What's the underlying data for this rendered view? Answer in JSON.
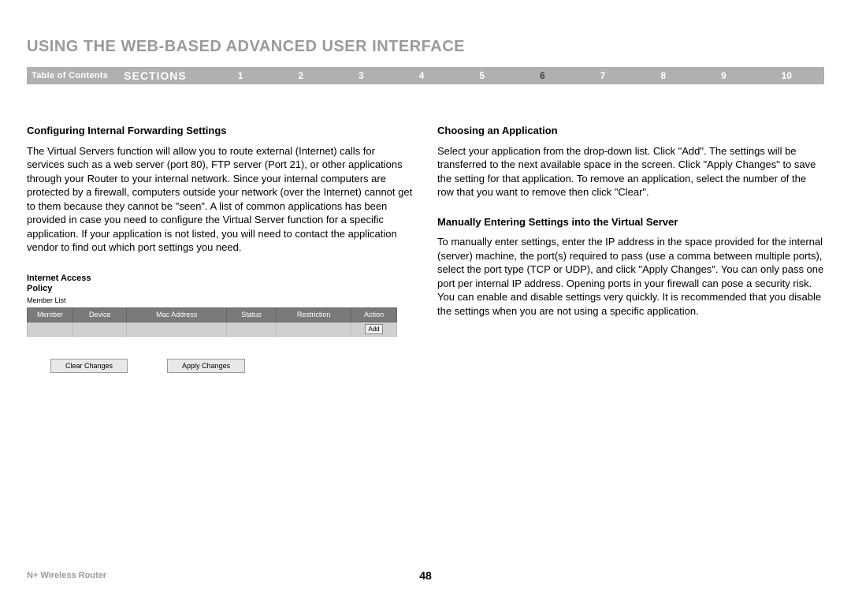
{
  "title": "USING THE WEB-BASED ADVANCED USER INTERFACE",
  "nav": {
    "toc": "Table of Contents",
    "sections_label": "SECTIONS",
    "sections": [
      "1",
      "2",
      "3",
      "4",
      "5",
      "6",
      "7",
      "8",
      "9",
      "10"
    ],
    "active": "6"
  },
  "left": {
    "h1": "Configuring Internal Forwarding Settings",
    "p1": "The Virtual Servers function will allow you to route external (Internet) calls for services such as a web server (port 80), FTP server (Port 21), or other applications through your Router to your internal network. Since your internal computers are protected by a firewall, computers outside your network (over the Internet) cannot get to them because they cannot be \"seen\". A list of common applications has been provided in case you need to configure the Virtual Server function for a specific application. If your application is not listed, you will need to contact the application vendor to find out which port settings you need.",
    "policy": {
      "title_line1": "Internet Access",
      "title_line2": "Policy",
      "member_list": "Member List",
      "headers": [
        "Member",
        "Device",
        "Mac Address",
        "Status",
        "Restriction",
        "Action"
      ],
      "add_btn": "Add",
      "clear_btn": "Clear Changes",
      "apply_btn": "Apply Changes"
    }
  },
  "right": {
    "h1": "Choosing an Application",
    "p1": "Select your application from the drop-down list. Click \"Add\". The settings will be transferred to the next available space in the screen. Click \"Apply Changes\" to save the setting for that application. To remove an application, select the number of the row that you want to remove then click \"Clear\".",
    "h2": "Manually Entering Settings into the Virtual Server",
    "p2": "To manually enter settings, enter the IP address in the space provided for the internal (server) machine, the port(s) required to pass (use a comma between multiple ports), select the port type (TCP or UDP), and click \"Apply Changes\". You can only pass one port per internal IP address. Opening ports in your firewall can pose a security risk. You can enable and disable settings very quickly. It is recommended that you disable the settings when you are not using a specific application."
  },
  "footer": {
    "product": "N+ Wireless Router",
    "page": "48"
  }
}
